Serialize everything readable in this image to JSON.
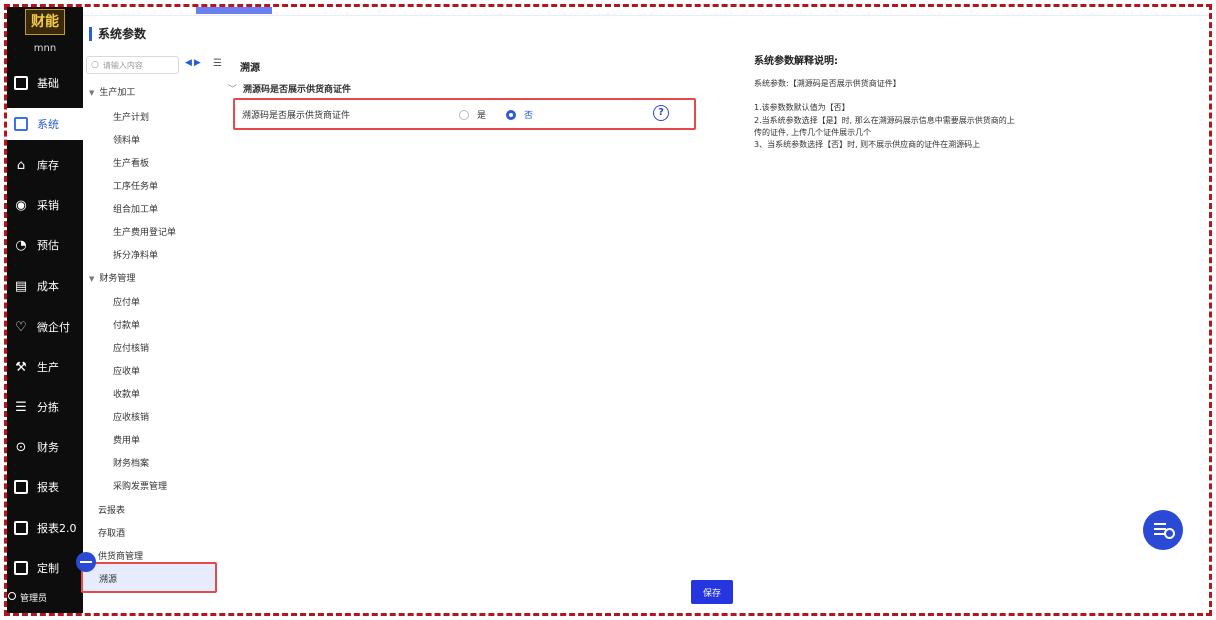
{
  "app": {
    "logo_text": "财能",
    "username": "mnn",
    "admin_label": "管理员"
  },
  "nav": {
    "items": [
      {
        "label": "基础",
        "icon": "grid-icon"
      },
      {
        "label": "系统",
        "icon": "system-settings-icon",
        "active": true
      },
      {
        "label": "库存",
        "icon": "warehouse-icon"
      },
      {
        "label": "采销",
        "icon": "purchase-sales-icon"
      },
      {
        "label": "预估",
        "icon": "estimate-icon"
      },
      {
        "label": "成本",
        "icon": "cost-icon"
      },
      {
        "label": "微企付",
        "icon": "wechat-pay-icon"
      },
      {
        "label": "生产",
        "icon": "production-icon"
      },
      {
        "label": "分拣",
        "icon": "sorting-icon"
      },
      {
        "label": "财务",
        "icon": "finance-icon"
      },
      {
        "label": "报表",
        "icon": "report-icon"
      },
      {
        "label": "报表2.0",
        "icon": "report-v2-icon"
      },
      {
        "label": "定制",
        "icon": "custom-icon"
      }
    ]
  },
  "page": {
    "title": "系统参数"
  },
  "search": {
    "placeholder": "请输入内容"
  },
  "tree": {
    "group_production": "生产加工",
    "production_items": [
      "生产计划",
      "领料单",
      "生产看板",
      "工序任务单",
      "组合加工单",
      "生产费用登记单",
      "拆分净料单"
    ],
    "group_finance": "财务管理",
    "finance_items": [
      "应付单",
      "付款单",
      "应付核销",
      "应收单",
      "收款单",
      "应收核销",
      "费用单",
      "财务档案",
      "采购发票管理"
    ],
    "top_items": [
      "云报表",
      "存取酒",
      "供货商管理"
    ],
    "selected_item": "溯源"
  },
  "content": {
    "section_title": "溯源",
    "sub_title": "溯源码是否展示供货商证件",
    "param_label": "溯源码是否展示供货商证件",
    "option_yes": "是",
    "option_no": "否",
    "selected_option": "否",
    "save_label": "保存"
  },
  "description": {
    "title": "系统参数解释说明:",
    "lines": [
      "系统参数:【溯源码是否展示供货商证件】",
      "1.该参数数默认值为【否】",
      "2.当系统参数选择【是】时, 那么在溯源码展示信息中需要展示供货商的上",
      "传的证件, 上传几个证件展示几个",
      "3、当系统参数选择【否】时, 则不展示供应商的证件在溯源码上"
    ]
  },
  "colors": {
    "accent": "#2a5cd6",
    "highlight_border": "#e34a4a",
    "nav_bg": "#0d0d0d",
    "frame": "#b3171d"
  }
}
